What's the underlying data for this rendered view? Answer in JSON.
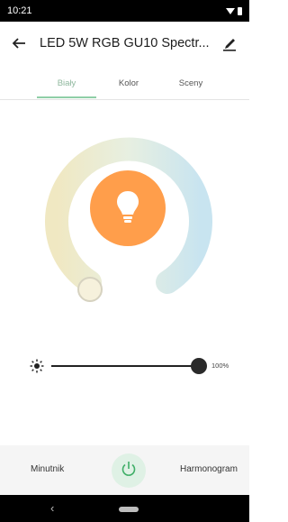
{
  "status": {
    "time": "10:21"
  },
  "header": {
    "title": "LED 5W RGB GU10 Spectr..."
  },
  "tabs": [
    {
      "label": "Biały",
      "active": true
    },
    {
      "label": "Kolor",
      "active": false
    },
    {
      "label": "Sceny",
      "active": false
    }
  ],
  "light": {
    "brightness_label": "100%",
    "brightness_fraction": 1.0,
    "bulb_color": "#ff9e4b"
  },
  "bottom": {
    "timer_label": "Minutnik",
    "schedule_label": "Harmonogram"
  },
  "colors": {
    "accent": "#8fcfa7",
    "warm": "#f3eac9",
    "cool": "#cfe6f1"
  },
  "icons": [
    "back-arrow-icon",
    "edit-icon",
    "sun-icon",
    "bulb-icon",
    "power-icon",
    "nav-back-icon",
    "nav-home-icon",
    "wifi-icon",
    "battery-icon"
  ]
}
